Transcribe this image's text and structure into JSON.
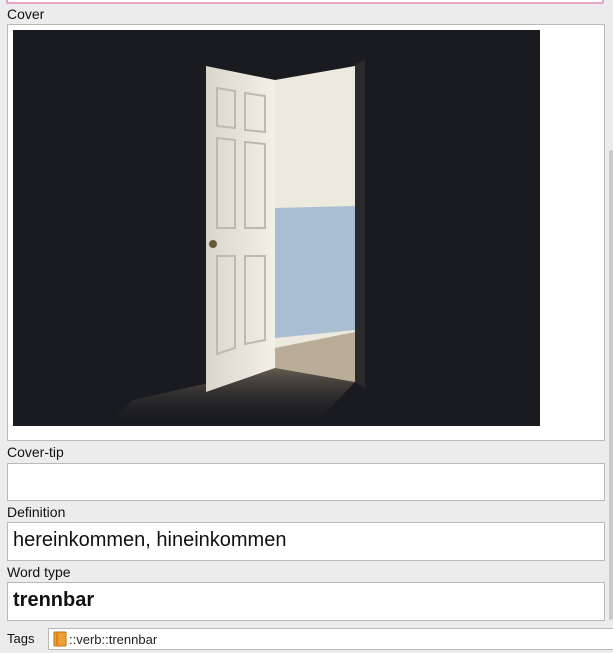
{
  "fields": {
    "cover": {
      "label": "Cover"
    },
    "cover_tip": {
      "label": "Cover-tip",
      "value": ""
    },
    "definition": {
      "label": "Definition",
      "value": "hereinkommen, hineinkommen"
    },
    "word_type": {
      "label": "Word type",
      "value": "trennbar"
    }
  },
  "tags": {
    "label": "Tags",
    "value": "::verb::trennbar",
    "icon": "tag-book-icon"
  },
  "colors": {
    "focus_border": "#e6a4c4",
    "field_border": "#b9b9b9",
    "background": "#ececec"
  },
  "image": {
    "icon": "cover-photo",
    "subject": "open door in dark room"
  }
}
